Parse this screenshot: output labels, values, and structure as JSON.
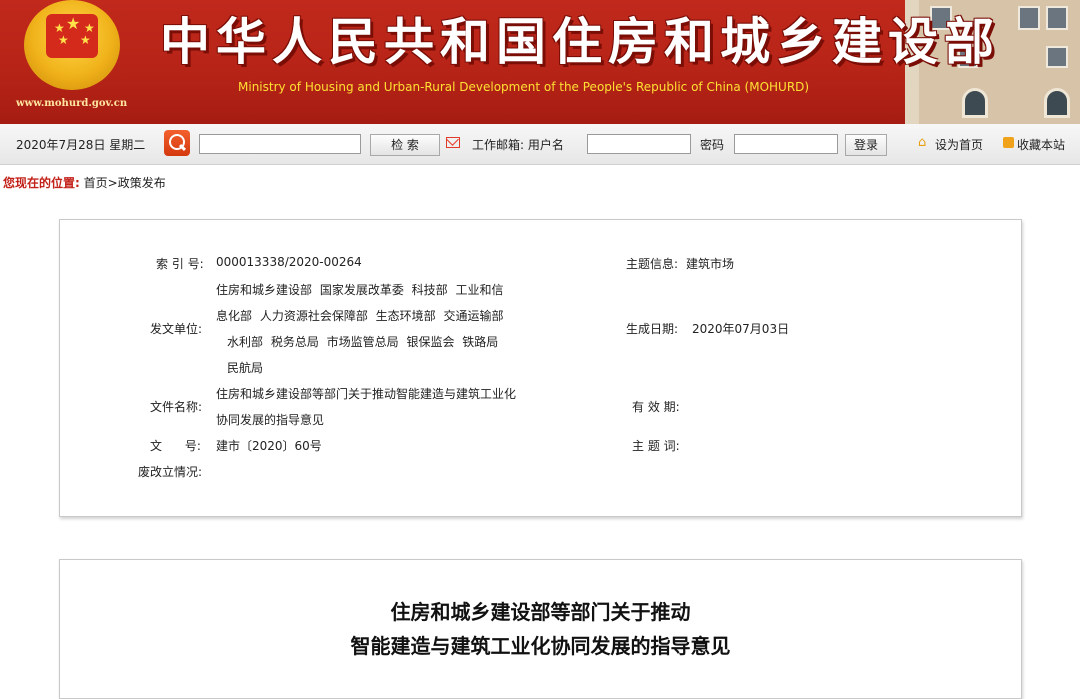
{
  "header": {
    "title_cn": "中华人民共和国住房和城乡建设部",
    "title_en": "Ministry of Housing and Urban-Rural Development of the People's Republic of China (MOHURD)",
    "site_url": "www.mohurd.gov.cn"
  },
  "toolbar": {
    "date": "2020年7月28日 星期二",
    "search_button": "检  索",
    "mail_label": "工作邮箱: 用户名",
    "password_label": "密码",
    "login_button": "登录",
    "set_home": "设为首页",
    "bookmark": "收藏本站"
  },
  "breadcrumb": {
    "label": "您现在的位置:",
    "path": "首页>政策发布"
  },
  "info": {
    "index_label": "索 引 号:",
    "index_value": "000013338/2020-00264",
    "topic_label": "主题信息:",
    "topic_value": "建筑市场",
    "issuer_label": "发文单位:",
    "issuer_lines": [
      "住房和城乡建设部  国家发展改革委  科技部  工业和信",
      "息化部  人力资源社会保障部  生态环境部  交通运输部",
      "水利部  税务总局  市场监管总局  银保监会  铁路局",
      "民航局"
    ],
    "date_label": "生成日期:",
    "date_value": "2020年07月03日",
    "docname_label": "文件名称:",
    "docname_lines": [
      "住房和城乡建设部等部门关于推动智能建造与建筑工业化",
      "协同发展的指导意见"
    ],
    "validity_label": "有 效 期:",
    "docno_label": "文      号:",
    "docno_value": "建市〔2020〕60号",
    "keywords_label": "主 题 词:",
    "status_label": "废改立情况:"
  },
  "article": {
    "title_line1": "住房和城乡建设部等部门关于推动",
    "title_line2": "智能建造与建筑工业化协同发展的指导意见"
  }
}
